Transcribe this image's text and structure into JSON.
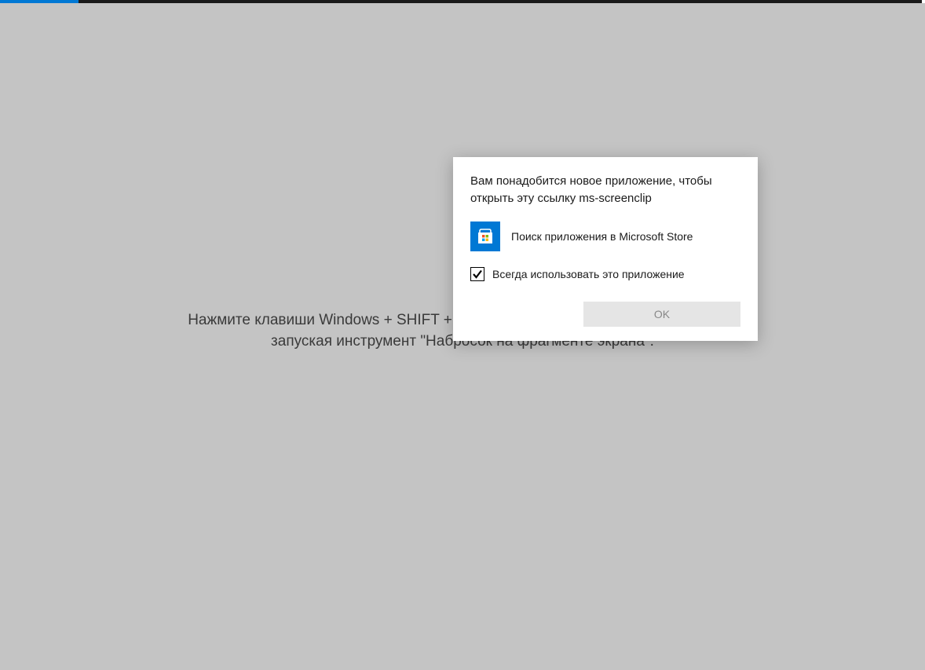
{
  "background": {
    "hint_text": "Нажмите клавиши Windows + SHIFT + S, чтобы захватить фрагмент экрана, не запуская инструмент \"Набросок на фрагменте экрана\"."
  },
  "dialog": {
    "title": "Вам понадобится новое приложение, чтобы открыть эту ссылку ms-screenclip",
    "store_option_label": "Поиск приложения в Microsoft Store",
    "always_use_label": "Всегда использовать это приложение",
    "always_use_checked": true,
    "ok_label": "OK"
  },
  "colors": {
    "accent": "#0078d4",
    "background": "#c4c4c4",
    "dialog_bg": "#ffffff"
  }
}
